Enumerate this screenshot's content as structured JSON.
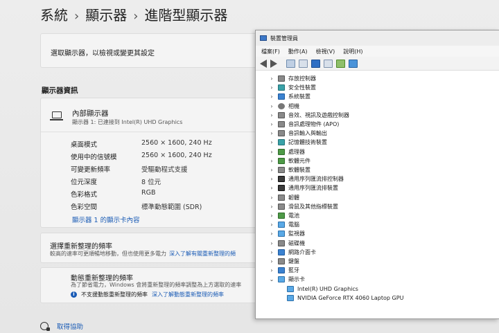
{
  "settings": {
    "breadcrumb": [
      "系統",
      "顯示器",
      "進階型顯示器"
    ],
    "intro": "選取顯示器，以檢視或變更其設定",
    "section_title": "顯示器資訊",
    "display": {
      "name": "內部顯示器",
      "subtitle": "顯示器 1: 已連接到 Intel(R) UHD Graphics",
      "rows": [
        {
          "key": "桌面模式",
          "value": "2560 × 1600, 240 Hz"
        },
        {
          "key": "使用中的信號模",
          "value": "2560 × 1600, 240 Hz"
        },
        {
          "key": "可變更新頻率",
          "value": "受驅動程式支援"
        },
        {
          "key": "位元深度",
          "value": "8 位元"
        },
        {
          "key": "色彩格式",
          "value": "RGB"
        },
        {
          "key": "色彩空間",
          "value": "標準動態範圍 (SDR)"
        }
      ],
      "adapter_link": "顯示器 1 的顯示卡內容"
    },
    "refresh": {
      "title": "選擇重新整理的頻率",
      "desc": "較高的速率可更順暢地移動，但也使用更多電力",
      "link": "深入了解有關重新整理的頻"
    },
    "dynamic": {
      "title": "動態重新整理的頻率",
      "desc": "為了節省電力，Windows 會將重新整理的頻率調整為上方選取的速率",
      "note": "不支援動態重新整理的頻率",
      "note_link": "深入了解動態重新整理的頻率"
    },
    "help": "取得協助"
  },
  "device_manager": {
    "title": "裝置管理員",
    "menu": [
      "檔案(F)",
      "動作(A)",
      "檢視(V)",
      "說明(H)"
    ],
    "categories": [
      {
        "label": "存放控制器",
        "icon": "storage-controller-icon",
        "expanded": false
      },
      {
        "label": "安全性裝置",
        "icon": "security-device-icon",
        "expanded": false
      },
      {
        "label": "系統裝置",
        "icon": "system-device-icon",
        "expanded": false
      },
      {
        "label": "相機",
        "icon": "camera-icon",
        "expanded": false
      },
      {
        "label": "音效、視訊及遊戲控制器",
        "icon": "audio-icon",
        "expanded": false
      },
      {
        "label": "音訊處理物件 (APO)",
        "icon": "audio-processing-icon",
        "expanded": false
      },
      {
        "label": "音訊輸入與輸出",
        "icon": "audio-io-icon",
        "expanded": false
      },
      {
        "label": "記憶體技術裝置",
        "icon": "memory-icon",
        "expanded": false
      },
      {
        "label": "處理器",
        "icon": "processor-icon",
        "expanded": false
      },
      {
        "label": "軟體元件",
        "icon": "software-component-icon",
        "expanded": false
      },
      {
        "label": "軟體裝置",
        "icon": "software-device-icon",
        "expanded": false
      },
      {
        "label": "通用序列匯流排控制器",
        "icon": "usb-controller-icon",
        "expanded": false
      },
      {
        "label": "通用序列匯流排裝置",
        "icon": "usb-device-icon",
        "expanded": false
      },
      {
        "label": "韌體",
        "icon": "firmware-icon",
        "expanded": false
      },
      {
        "label": "滑鼠及其他指標裝置",
        "icon": "mouse-icon",
        "expanded": false
      },
      {
        "label": "電池",
        "icon": "battery-icon",
        "expanded": false
      },
      {
        "label": "電腦",
        "icon": "computer-icon",
        "expanded": false
      },
      {
        "label": "監視器",
        "icon": "monitor-icon",
        "expanded": false
      },
      {
        "label": "磁碟機",
        "icon": "disk-icon",
        "expanded": false
      },
      {
        "label": "網路介面卡",
        "icon": "network-adapter-icon",
        "expanded": false
      },
      {
        "label": "鍵盤",
        "icon": "keyboard-icon",
        "expanded": false
      },
      {
        "label": "藍牙",
        "icon": "bluetooth-icon",
        "expanded": false
      },
      {
        "label": "顯示卡",
        "icon": "display-adapter-icon",
        "expanded": true
      }
    ],
    "display_adapters": [
      {
        "label": "Intel(R) UHD Graphics",
        "icon": "gpu-icon"
      },
      {
        "label": "NVIDIA GeForce RTX 4060 Laptop GPU",
        "icon": "gpu-icon"
      }
    ]
  }
}
